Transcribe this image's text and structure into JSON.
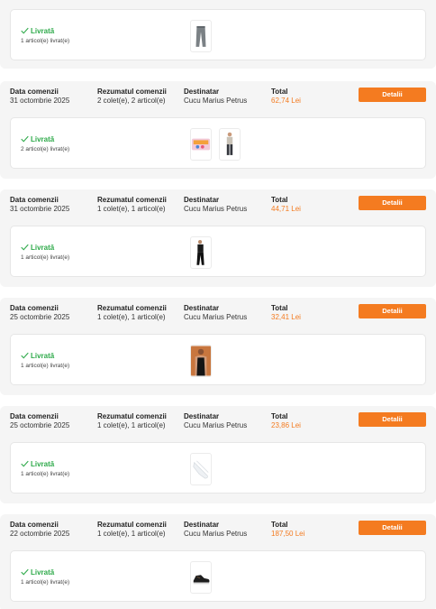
{
  "labels": {
    "order_date": "Data comenzii",
    "order_summary": "Rezumatul comenzii",
    "recipient": "Destinatar",
    "total": "Total",
    "details": "Detalii",
    "delivered": "Livrată"
  },
  "first_shipment": {
    "status": "Livrată",
    "items_delivered": "1 articol(e) livrat(e)",
    "thumbnails": [
      "jeans-icon"
    ]
  },
  "orders": [
    {
      "date": "31 octombrie 2025",
      "summary": "2 colet(e), 2 articol(e)",
      "recipient": "Cucu Marius Petrus",
      "total": "62,74 Lei",
      "items_delivered": "2 articol(e) livrat(e)",
      "thumbnails": [
        "diapers-pack-icon",
        "man-outfit-icon"
      ]
    },
    {
      "date": "31 octombrie 2025",
      "summary": "1 colet(e), 1 articol(e)",
      "recipient": "Cucu Marius Petrus",
      "total": "44,71 Lei",
      "items_delivered": "1 articol(e) livrat(e)",
      "thumbnails": [
        "black-pants-icon"
      ]
    },
    {
      "date": "25 octombrie 2025",
      "summary": "1 colet(e), 1 articol(e)",
      "recipient": "Cucu Marius Petrus",
      "total": "32,41 Lei",
      "items_delivered": "1 articol(e) livrat(e)",
      "thumbnails": [
        "tank-top-icon"
      ]
    },
    {
      "date": "25 octombrie 2025",
      "summary": "1 colet(e), 1 articol(e)",
      "recipient": "Cucu Marius Petrus",
      "total": "23,86 Lei",
      "items_delivered": "1 articol(e) livrat(e)",
      "thumbnails": [
        "white-socks-icon"
      ]
    },
    {
      "date": "22 octombrie 2025",
      "summary": "1 colet(e), 1 articol(e)",
      "recipient": "Cucu Marius Petrus",
      "total": "187,50 Lei",
      "items_delivered": "1 articol(e) livrat(e)",
      "thumbnails": [
        "sneaker-icon"
      ]
    }
  ],
  "colors": {
    "accent": "#f47b20",
    "delivered": "#2eaa4a",
    "panel": "#f5f5f5"
  }
}
